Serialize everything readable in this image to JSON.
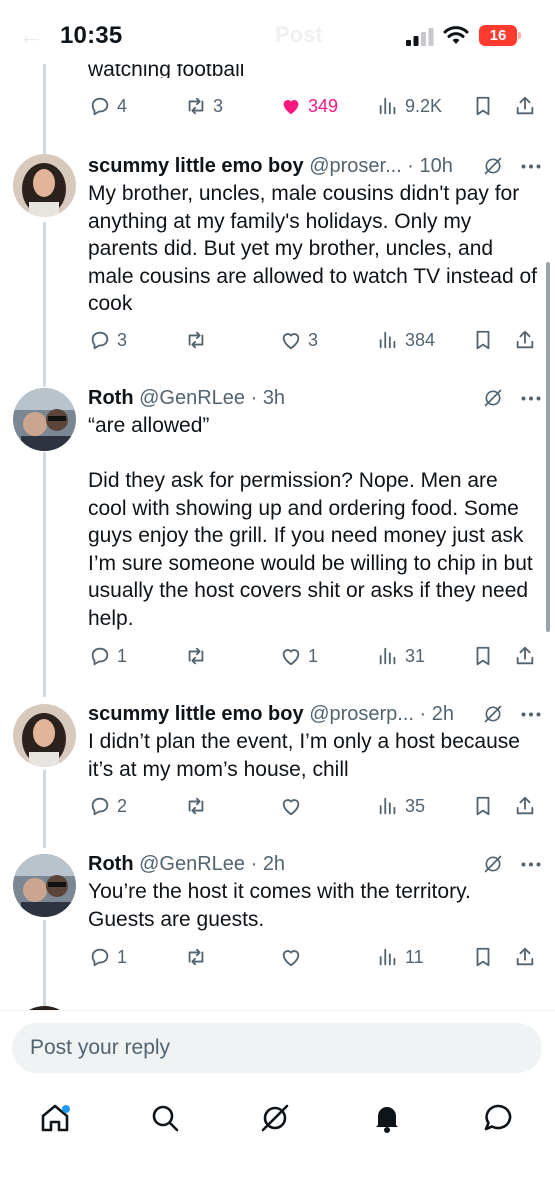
{
  "status_bar": {
    "time": "10:35",
    "battery": "16",
    "ghost_title": "Post",
    "back_icon": "arrow-left-icon"
  },
  "top_partial": {
    "text": "watching football",
    "actions": {
      "replies": "4",
      "reposts": "3",
      "likes": "349",
      "views": "9.2K"
    },
    "liked_color": "#f91880"
  },
  "tweets": [
    {
      "name": "scummy little emo boy",
      "handle": "@proser...",
      "time": "10h",
      "text": "My brother, uncles, male cousins didn't pay for anything at my family's holidays. Only my parents did. But yet my brother, uncles, and male cousins are allowed to watch TV instead of cook",
      "replies": "3",
      "reposts": "",
      "likes": "3",
      "views": "384"
    },
    {
      "name": "Roth",
      "handle": "@GenRLee",
      "time": "3h",
      "text": "“are allowed”\n\nDid they ask for permission? Nope. Men are cool with showing up and ordering food. Some guys enjoy the grill. If you need money just ask I’m sure someone would be willing to chip in but usually the host covers shit or asks if they need help.",
      "replies": "1",
      "reposts": "",
      "likes": "1",
      "views": "31"
    },
    {
      "name": "scummy little emo boy",
      "handle": "@proserp...",
      "time": "2h",
      "text": "I didn’t plan the event, I’m only a host because it’s at my mom’s house, chill",
      "replies": "2",
      "reposts": "",
      "likes": "",
      "views": "35"
    },
    {
      "name": "Roth",
      "handle": "@GenRLee",
      "time": "2h",
      "text": "You’re the host it comes with the territory. Guests are guests.",
      "replies": "1",
      "reposts": "",
      "likes": "",
      "views": "11"
    }
  ],
  "reply_bar": {
    "placeholder": "Post your reply"
  },
  "tabbar": {
    "items": [
      "home-icon",
      "search-icon",
      "grok-icon",
      "notifications-icon",
      "messages-icon"
    ]
  },
  "colors": {
    "text": "#0f1419",
    "secondary": "#536471",
    "thread_line": "#cfd9de",
    "accent": "#1d9bf0",
    "battery": "#ff3b30"
  }
}
